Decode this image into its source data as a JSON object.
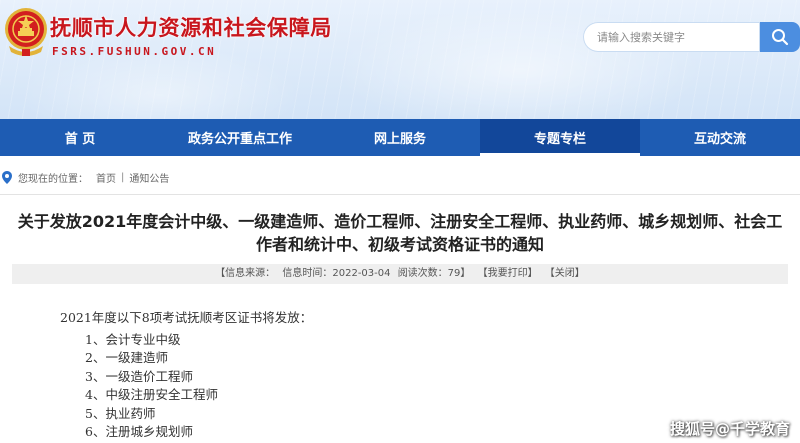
{
  "site": {
    "title": "抚顺市人力资源和社会保障局",
    "domain": "FSRS.FUSHUN.GOV.CN",
    "emblem_icon": "national-emblem-icon"
  },
  "search": {
    "placeholder": "请输入搜索关键字",
    "icon": "search-icon"
  },
  "nav": {
    "items": [
      {
        "label": "首 页",
        "active": false
      },
      {
        "label": "政务公开重点工作",
        "active": false
      },
      {
        "label": "网上服务",
        "active": false
      },
      {
        "label": "专题专栏",
        "active": true
      },
      {
        "label": "互动交流",
        "active": false
      }
    ]
  },
  "breadcrumb": {
    "icon": "location-pin-icon",
    "prefix": "您现在的位置：",
    "items": [
      "首页",
      "通知公告"
    ],
    "separator": "|"
  },
  "article": {
    "title": "关于发放2021年度会计中级、一级建造师、造价工程师、注册安全工程师、执业药师、城乡规划师、社会工作者和统计中、初级考试资格证书的通知",
    "meta": {
      "source": "【信息来源：",
      "time": "信息时间：2022-03-04",
      "views": "阅读次数：79】",
      "print": "【我要打印】",
      "close": "【关闭】"
    },
    "intro": "2021年度以下8项考试抚顺考区证书将发放：",
    "list": [
      "1、会计专业中级",
      "2、一级建造师",
      "3、一级造价工程师",
      "4、中级注册安全工程师",
      "5、执业药师",
      "6、注册城乡规划师"
    ]
  },
  "watermark": "搜狐号@千学教育",
  "colors": {
    "brand_red": "#c8161d",
    "nav_blue": "#1e5cb3",
    "nav_active": "#12479a",
    "search_button": "#4c8ee0",
    "meta_bar": "#efefef"
  }
}
